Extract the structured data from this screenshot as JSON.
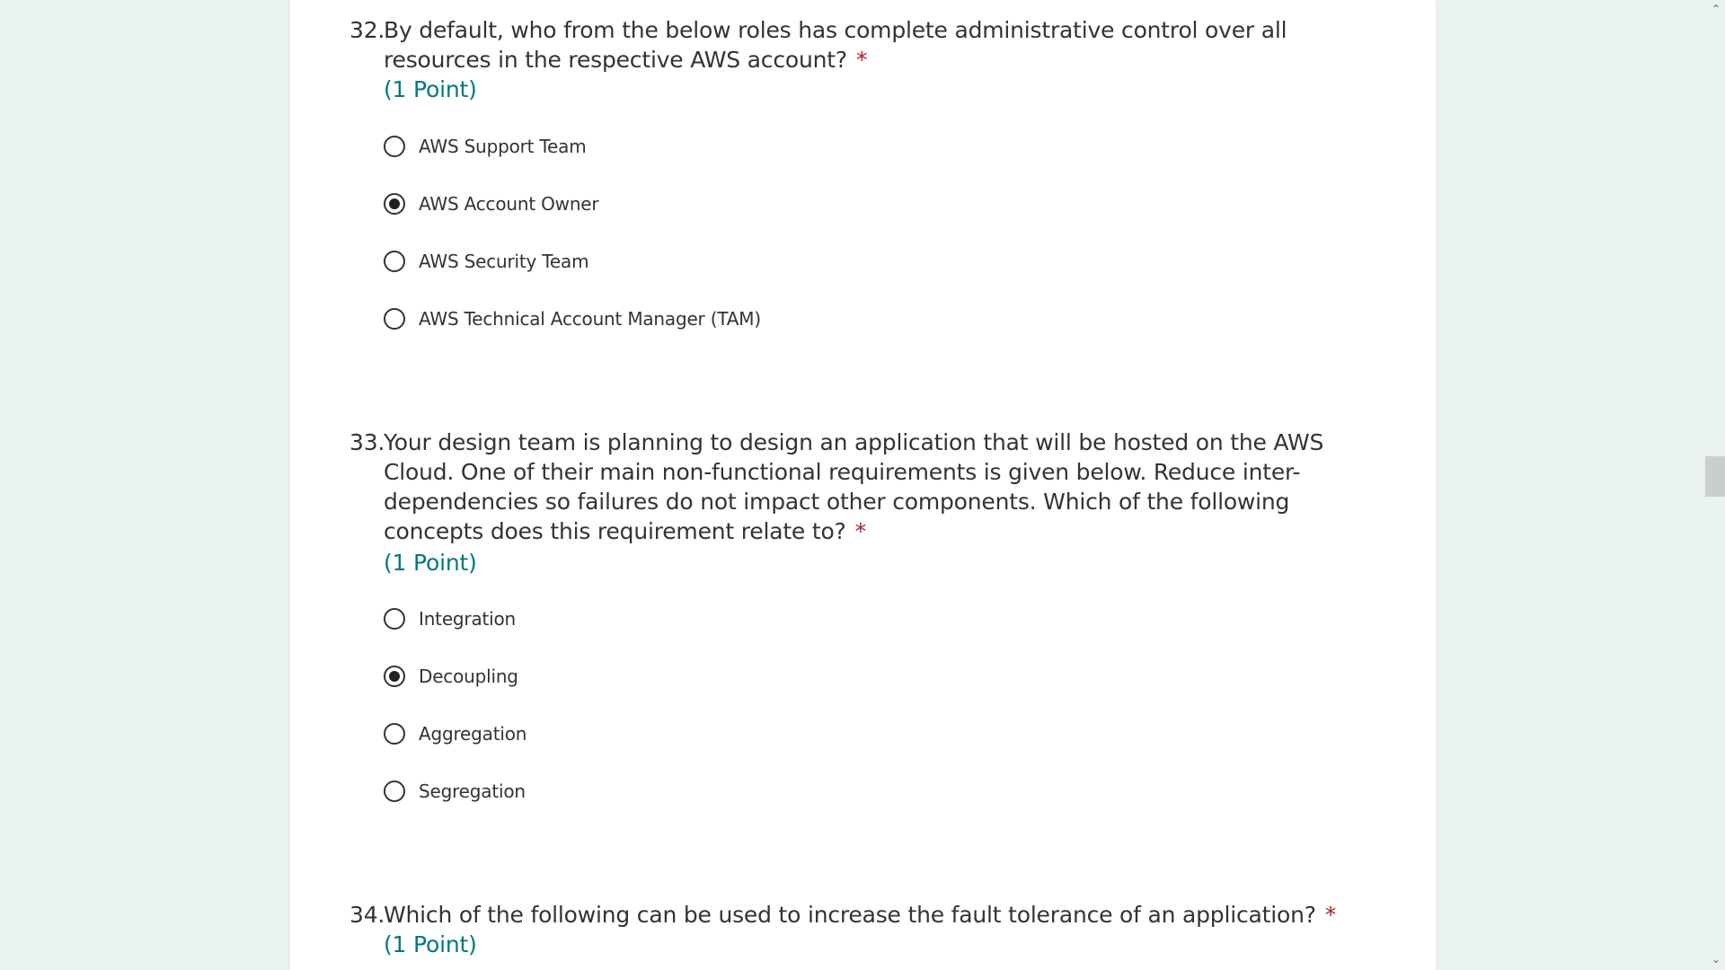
{
  "questions": [
    {
      "number": "32.",
      "text": "By default, who from the below roles has complete administrative control over all resources in the respective AWS account?",
      "required_mark": "*",
      "points": "(1 Point)",
      "options": [
        {
          "label": "AWS Support Team",
          "selected": false
        },
        {
          "label": "AWS Account Owner",
          "selected": true
        },
        {
          "label": "AWS Security Team",
          "selected": false
        },
        {
          "label": "AWS Technical Account Manager (TAM)",
          "selected": false
        }
      ]
    },
    {
      "number": "33.",
      "text": "Your design team is planning to design an application that will be hosted on the AWS Cloud. One of their main non-functional requirements is given below. Reduce inter-dependencies so failures do not impact other components. Which of the following concepts does this requirement relate to?",
      "required_mark": "*",
      "points": "(1 Point)",
      "options": [
        {
          "label": "Integration",
          "selected": false
        },
        {
          "label": "Decoupling",
          "selected": true
        },
        {
          "label": "Aggregation",
          "selected": false
        },
        {
          "label": "Segregation",
          "selected": false
        }
      ]
    },
    {
      "number": "34.",
      "text": "Which of the following can be used to increase the fault tolerance of an application?",
      "required_mark": "*",
      "points": "(1 Point)",
      "options": []
    }
  ],
  "scrollbar": {
    "up_arrow": "⌃",
    "down_arrow": "⌄"
  },
  "colors": {
    "background": "#eaf1f1",
    "card": "#ffffff",
    "points": "#03787c",
    "required": "#a4262c"
  }
}
